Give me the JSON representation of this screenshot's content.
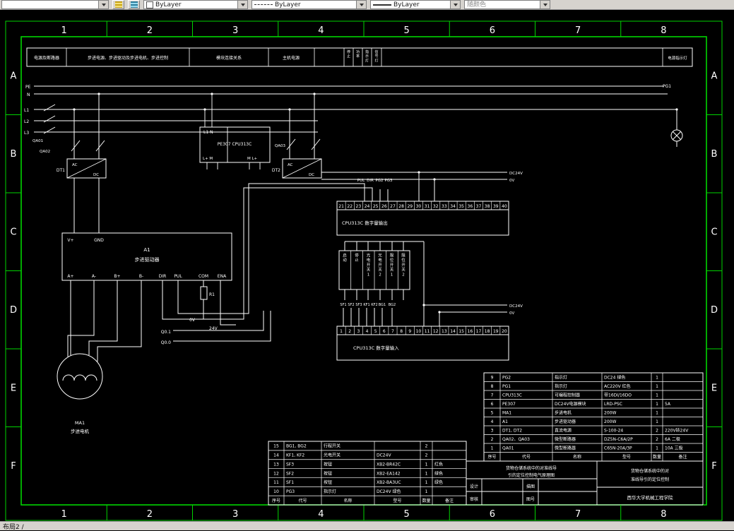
{
  "toolbar": {
    "layer_value": "",
    "color_value": "ByLayer",
    "linetype_value": "ByLayer",
    "lineweight_value": "ByLayer",
    "plotstyle_value": "随颜色"
  },
  "statusbar": {
    "layout_tab": "布局2 /"
  },
  "zones": {
    "columns": [
      "1",
      "2",
      "3",
      "4",
      "5",
      "6",
      "7",
      "8"
    ],
    "rows": [
      "A",
      "B",
      "C",
      "D",
      "E",
      "F"
    ]
  },
  "header_strip": {
    "cells": [
      "电源及断路器",
      "步进电源、步进驱动及步进电机、步进控制",
      "模块连接关系",
      "主机电源"
    ],
    "narrow_cells": [
      "停止",
      "功率",
      "指示灯",
      "信号灯"
    ],
    "right_cell": "电源指示灯"
  },
  "rails": {
    "pe": "PE",
    "n": "N",
    "l1": "L1",
    "l2": "L2",
    "l3": "L3"
  },
  "components": {
    "qa01": "QA01",
    "qa02": "QA02",
    "qa03": "QA03",
    "dt1": "DT1",
    "dt2": "DT2",
    "ac": "AC",
    "dc": "DC",
    "pg1": "PG1",
    "plc_top": "L1 N",
    "plc_name": "PE307 CPU313C",
    "plc_bottom_left": "L+ M",
    "plc_bottom_right": "M L+",
    "driver_id": "A1",
    "driver_name": "步进驱动器",
    "vplus": "V+",
    "gnd": "GND",
    "terminals": [
      "A+",
      "A-",
      "B+",
      "B-",
      "DIR",
      "PUL",
      "COM",
      "ENA"
    ],
    "r1": "R1",
    "v0": "0V",
    "v24": "24V",
    "q01": "Q0.1",
    "q00": "Q0.0",
    "motor_id": "MA1",
    "motor_name": "步进电机",
    "bundle_labels": [
      "PUL",
      "DIR",
      "PG2",
      "PG3"
    ],
    "dc24v": "DC24V",
    "zero_v": "0V",
    "out_module": "CPU313C 数字量输出",
    "in_module": "CPU313C 数字量输入",
    "input_labels": [
      "SF1",
      "SF2",
      "SF3",
      "KF1",
      "KF2",
      "BG1",
      "BG2"
    ],
    "switch_columns": [
      "启动",
      "停止",
      "光电开关1",
      "光电开关2",
      "限位开关1",
      "限位开关2"
    ]
  },
  "out_strip": [
    "21",
    "22",
    "23",
    "24",
    "25",
    "26",
    "27",
    "28",
    "29",
    "30",
    "31",
    "32",
    "33",
    "34",
    "35",
    "36",
    "37",
    "38",
    "39",
    "40"
  ],
  "in_strip": [
    "1",
    "2",
    "3",
    "4",
    "5",
    "6",
    "7",
    "8",
    "9",
    "10",
    "11",
    "12",
    "13",
    "14",
    "15",
    "16",
    "17",
    "18",
    "19",
    "20"
  ],
  "left_table": {
    "headers": [
      "序号",
      "代号",
      "名称",
      "型号",
      "数量",
      "备注"
    ],
    "rows": [
      [
        "15",
        "BG1, BG2",
        "行程开关",
        "",
        "2",
        ""
      ],
      [
        "14",
        "KF1, KF2",
        "光电开关",
        "DC24V",
        "2",
        ""
      ],
      [
        "13",
        "SF3",
        "按钮",
        "XB2-BR42C",
        "1",
        "红色"
      ],
      [
        "12",
        "SF2",
        "按钮",
        "XB2-EA142",
        "1",
        "绿色"
      ],
      [
        "11",
        "SF1",
        "按钮",
        "XB2-BA3UC",
        "1",
        "绿色"
      ],
      [
        "10",
        "PG3",
        "指示灯",
        "DC24V 绿色",
        "1",
        ""
      ]
    ]
  },
  "right_table": {
    "headers": [
      "序号",
      "代号",
      "名称",
      "型号",
      "数量",
      "备注"
    ],
    "rows": [
      [
        "9",
        "PG2",
        "指示灯",
        "DC24 绿色",
        "1",
        ""
      ],
      [
        "8",
        "PG1",
        "指示灯",
        "AC220V 红色",
        "1",
        ""
      ],
      [
        "7",
        "CPU313C",
        "可编程控制器",
        "带16DI/16DO",
        "1",
        ""
      ],
      [
        "6",
        "PE307",
        "DC24V电源模块",
        "LRD-PSC",
        "1",
        "5A"
      ],
      [
        "5",
        "MA1",
        "步进电机",
        "200W",
        "1",
        ""
      ],
      [
        "4",
        "A1",
        "步进驱动器",
        "200W",
        "1",
        ""
      ],
      [
        "3",
        "DT1, DT2",
        "直流电源",
        "S-100-24",
        "2",
        "220V转24V"
      ],
      [
        "2",
        "QA02、QA03",
        "微型断路器",
        "DZ5N-C6A/2P",
        "2",
        "6A 二极"
      ],
      [
        "1",
        "QA01",
        "微型断路器",
        "C65N-20A/3P",
        "1",
        "10A 三极"
      ]
    ]
  },
  "title_block": {
    "design_label": "设计",
    "check_label": "审核",
    "trace_label": "描图",
    "number_label": "图号",
    "title_left": "货物仓储系统中的对准线导引的定位控制电气原理图",
    "title_right": "货物仓储系统中的对准线导引的定位控制",
    "school": "西华大学机械工程学院"
  },
  "colors": {
    "frame_green": "#00d400",
    "wire_white": "#ffffff",
    "canvas": "#000000"
  }
}
